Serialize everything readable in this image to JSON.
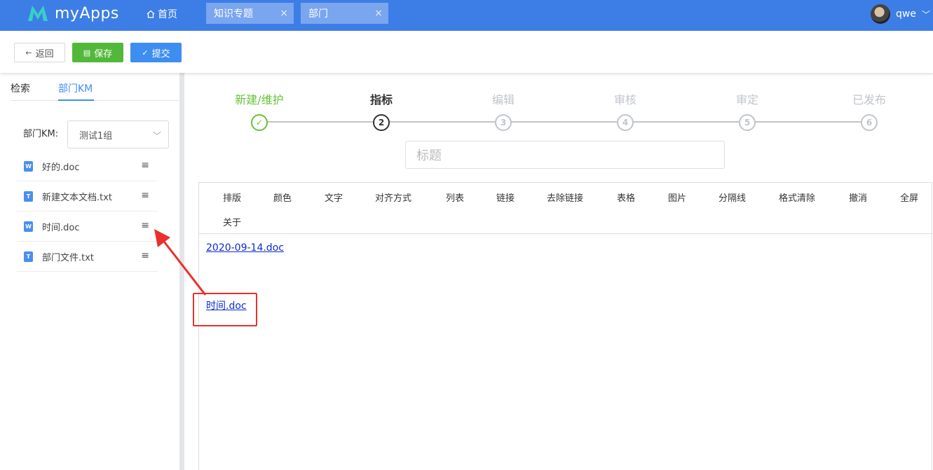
{
  "header": {
    "app_name": "myApps",
    "home_label": "首页",
    "tabs": [
      {
        "label": "知识专题"
      },
      {
        "label": "部门"
      }
    ],
    "close_glyph": "×",
    "username": "qwe",
    "brand_color": "#3d7ee6"
  },
  "toolbar": {
    "back_label": "返回",
    "save_label": "保存",
    "submit_label": "提交"
  },
  "sidebar": {
    "tabs": [
      "检索",
      "部门KM"
    ],
    "km_label": "部门KM:",
    "km_selected": "测试1组",
    "files": [
      {
        "name": "好的.doc",
        "type": "doc",
        "icon": "W"
      },
      {
        "name": "新建文本文档.txt",
        "type": "txt",
        "icon": "T"
      },
      {
        "name": "时间.doc",
        "type": "doc",
        "icon": "W"
      },
      {
        "name": "部门文件.txt",
        "type": "txt",
        "icon": "T"
      }
    ]
  },
  "steps": [
    {
      "title": "新建/维护",
      "index": "✓",
      "status": "done"
    },
    {
      "title": "指标",
      "index": "2",
      "status": "active"
    },
    {
      "title": "编辑",
      "index": "3",
      "status": "wait"
    },
    {
      "title": "审核",
      "index": "4",
      "status": "wait"
    },
    {
      "title": "审定",
      "index": "5",
      "status": "wait"
    },
    {
      "title": "已发布",
      "index": "6",
      "status": "wait"
    }
  ],
  "title_placeholder": "标题",
  "editor": {
    "tools": [
      "排版",
      "颜色",
      "文字",
      "对齐方式",
      "列表",
      "链接",
      "去除链接",
      "表格",
      "图片",
      "分隔线",
      "格式清除",
      "撤消",
      "全屏",
      "关于"
    ],
    "links": [
      "2020-09-14.doc",
      "时间.doc"
    ]
  },
  "annotation_color": "#e8312a"
}
